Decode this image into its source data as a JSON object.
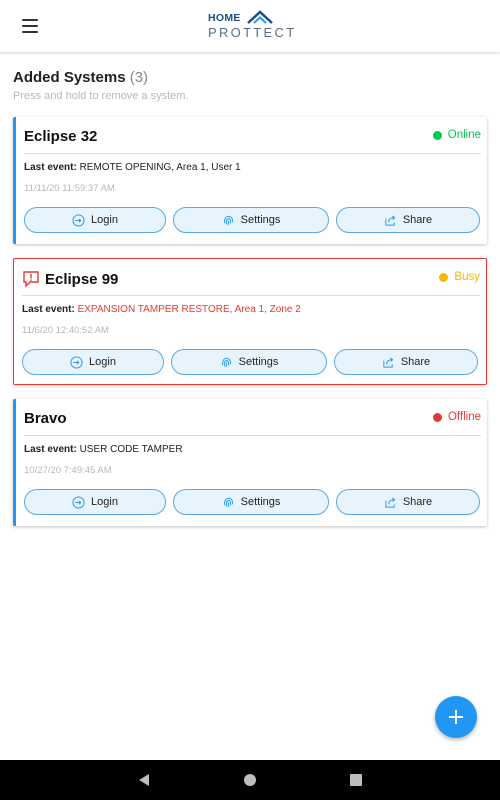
{
  "app": {
    "logo_home": "HOME",
    "logo_protect": "PROTTECT",
    "brand_color": "#1b4f8c",
    "accent": "#2196f3"
  },
  "list": {
    "title": "Added Systems",
    "count": "(3)",
    "hint": "Press and hold to remove a system."
  },
  "systems": [
    {
      "name": "Eclipse 32",
      "status": "Online",
      "status_color": "#00c853",
      "event_label": "Last event:",
      "event": "REMOTE OPENING, Area 1, User 1",
      "timestamp": "11/11/20 11:59:37 AM",
      "login": "Login",
      "settings": "Settings",
      "share": "Share"
    },
    {
      "name": "Eclipse 99",
      "status": "Busy",
      "status_color": "#f5b800",
      "event_label": "Last event:",
      "event": "EXPANSION TAMPER RESTORE, Area 1, Zone 2",
      "event_color": "#e53935",
      "timestamp": "11/6/20 12:40:52 AM",
      "login": "Login",
      "settings": "Settings",
      "share": "Share"
    },
    {
      "name": "Bravo",
      "status": "Offline",
      "status_color": "#e53935",
      "event_label": "Last event:",
      "event": "USER CODE TAMPER",
      "timestamp": "10/27/20 7:49:45 AM",
      "login": "Login",
      "settings": "Settings",
      "share": "Share"
    }
  ],
  "icons": {
    "menu": "hamburger-menu-icon",
    "login": "login-arrow-icon",
    "settings": "fingerprint-icon",
    "share": "share-icon",
    "alert": "alert-bubble-icon",
    "fab": "plus-icon"
  }
}
